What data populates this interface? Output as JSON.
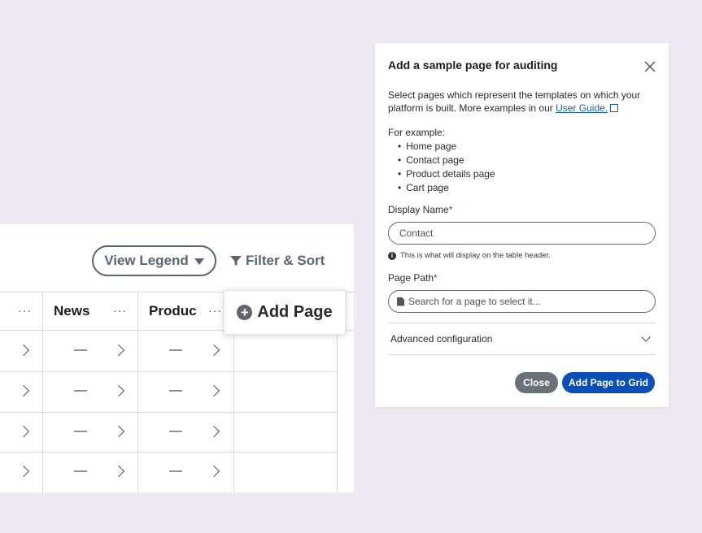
{
  "grid": {
    "view_legend_label": "View Legend",
    "filter_sort_label": "Filter & Sort",
    "columns": [
      {
        "title": "",
        "menu": "···"
      },
      {
        "title": "News",
        "menu": "···"
      },
      {
        "title": "Produc",
        "menu": "···"
      }
    ],
    "add_page_label": "Add Page",
    "rows": [
      {
        "cells": [
          "",
          "—",
          "—"
        ]
      },
      {
        "cells": [
          "",
          "—",
          "—"
        ]
      },
      {
        "cells": [
          "",
          "—",
          "—"
        ]
      },
      {
        "cells": [
          "",
          "—",
          "—"
        ]
      }
    ]
  },
  "dialog": {
    "title": "Add a sample page for auditing",
    "description": "Select pages which represent the templates on which your platform is built. More examples in our",
    "guide_link": "User Guide.",
    "example_heading": "For example:",
    "examples": [
      "Home page",
      "Contact page",
      "Product details page",
      "Cart page"
    ],
    "display_name_label": "Display Name",
    "display_name_value": "Contact",
    "display_name_hint": "This is what will display on the table header.",
    "page_path_label": "Page Path",
    "page_path_placeholder": "Search for a page to select it...",
    "advanced_label": "Advanced configuration",
    "close_label": "Close",
    "submit_label": "Add Page to Grid",
    "required_mark": "*"
  }
}
